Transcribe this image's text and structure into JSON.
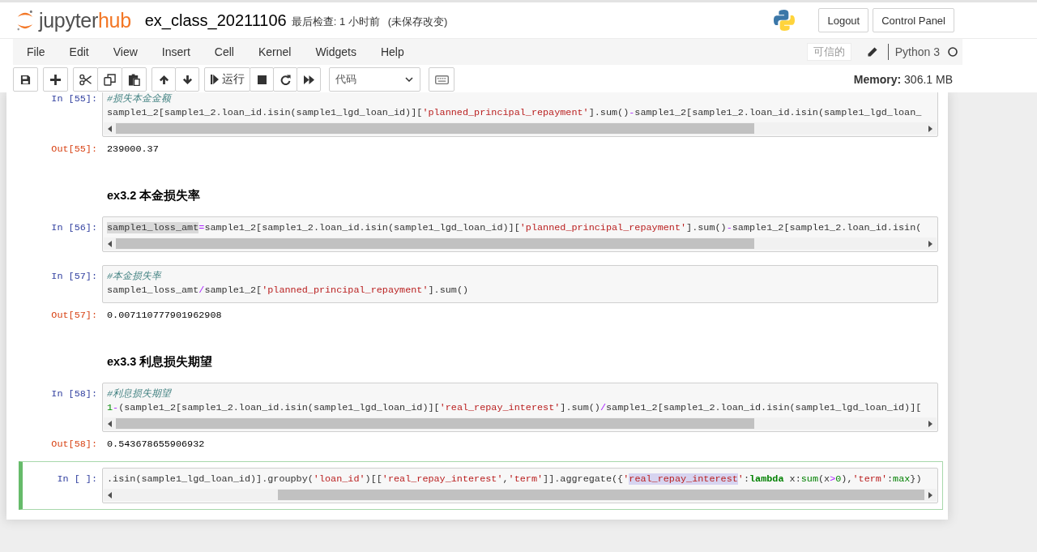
{
  "header": {
    "logo": {
      "primary": "jupyter",
      "accent": "hub"
    },
    "notebook_name": "ex_class_20211106",
    "checkpoint": "最后检查: 1 小时前",
    "autosave_status": "(未保存改变)",
    "buttons": [
      "Logout",
      "Control Panel"
    ]
  },
  "menubar": {
    "items": [
      "File",
      "Edit",
      "View",
      "Insert",
      "Cell",
      "Kernel",
      "Widgets",
      "Help"
    ],
    "trusted": "可信的",
    "edit_mode": true,
    "kernel": {
      "name": "Python 3",
      "busy": false
    }
  },
  "toolbar": {
    "groups": [
      [
        {
          "kind": "save"
        }
      ],
      [
        {
          "kind": "insert-below"
        }
      ],
      [
        {
          "kind": "cut"
        },
        {
          "kind": "copy"
        },
        {
          "kind": "paste"
        }
      ],
      [
        {
          "kind": "move-up"
        },
        {
          "kind": "move-down"
        }
      ],
      [
        {
          "kind": "run",
          "label": "运行"
        },
        {
          "kind": "interrupt"
        },
        {
          "kind": "restart"
        },
        {
          "kind": "restart-run-all"
        }
      ],
      [
        {
          "kind": "cell-type",
          "value": "代码"
        }
      ],
      [
        {
          "kind": "command-palette"
        }
      ]
    ],
    "memory": "**Memory:** 306.1 MB"
  },
  "notebook": {
    "cells": [
      {
        "kind": "code",
        "selected": false,
        "prompt": "In [55]:",
        "scrolled": false,
        "input": [
          [
            {
              "kind": "comment",
              "text": "#损失本金金额"
            }
          ],
          [
            {
              "kind": "plain",
              "text": "sample1_2[sample1_2.loan_id.isin(sample1_lgd_loan_id)]["
            },
            {
              "kind": "string",
              "text": "'planned_principal_repayment'"
            },
            {
              "kind": "plain",
              "text": "].sum()"
            },
            {
              "kind": "operator",
              "text": "-"
            },
            {
              "kind": "plain",
              "text": "sample1_2[sample1_2.loan_id.isin(sample1_lgd_loan_"
            }
          ]
        ],
        "output": {
          "prompt": "Out[55]:",
          "text": "239000.37"
        }
      },
      {
        "kind": "markdown",
        "selected": false,
        "heading": "ex3.2 本金损失率"
      },
      {
        "kind": "code",
        "selected": false,
        "prompt": "In [56]:",
        "scrolled": false,
        "input": [
          [
            {
              "kind": "plain",
              "text": "sample1_loss_amt",
              "highlighted": true
            },
            {
              "kind": "operator",
              "text": "="
            },
            {
              "kind": "plain",
              "text": "sample1_2[sample1_2.loan_id.isin(sample1_lgd_loan_id)]["
            },
            {
              "kind": "string",
              "text": "'planned_principal_repayment'"
            },
            {
              "kind": "plain",
              "text": "].sum()"
            },
            {
              "kind": "operator",
              "text": "-"
            },
            {
              "kind": "plain",
              "text": "sample1_2[sample1_2.loan_id.isin("
            }
          ]
        ]
      },
      {
        "kind": "code",
        "selected": false,
        "prompt": "In [57]:",
        "input": [
          [
            {
              "kind": "comment",
              "text": "#本金损失率"
            }
          ],
          [
            {
              "kind": "plain",
              "text": "sample1_loss_amt"
            },
            {
              "kind": "operator",
              "text": "/"
            },
            {
              "kind": "plain",
              "text": "sample1_2["
            },
            {
              "kind": "string",
              "text": "'planned_principal_repayment'"
            },
            {
              "kind": "plain",
              "text": "].sum()"
            }
          ]
        ],
        "output": {
          "prompt": "Out[57]:",
          "text": "0.007110777901962908"
        }
      },
      {
        "kind": "markdown",
        "selected": false,
        "heading": "ex3.3 利息损失期望"
      },
      {
        "kind": "code",
        "selected": false,
        "prompt": "In [58]:",
        "scrolled": false,
        "input": [
          [
            {
              "kind": "comment",
              "text": "#利息损失期望"
            }
          ],
          [
            {
              "kind": "number",
              "text": "1"
            },
            {
              "kind": "operator",
              "text": "-"
            },
            {
              "kind": "plain",
              "text": "(sample1_2[sample1_2.loan_id.isin(sample1_lgd_loan_id)]["
            },
            {
              "kind": "string",
              "text": "'real_repay_interest'"
            },
            {
              "kind": "plain",
              "text": "].sum()"
            },
            {
              "kind": "operator",
              "text": "/"
            },
            {
              "kind": "plain",
              "text": "sample1_2[sample1_2.loan_id.isin(sample1_lgd_loan_id)]["
            }
          ]
        ],
        "output": {
          "prompt": "Out[58]:",
          "text": "0.543678655906932"
        }
      },
      {
        "kind": "code",
        "selected": true,
        "prompt": "In [ ]:",
        "scrolled": true,
        "input": [
          [
            {
              "kind": "plain",
              "text": ".isin(sample1_lgd_loan_id)].groupby("
            },
            {
              "kind": "string",
              "text": "'loan_id'"
            },
            {
              "kind": "plain",
              "text": ")[["
            },
            {
              "kind": "string",
              "text": "'real_repay_interest'"
            },
            {
              "kind": "plain",
              "text": ","
            },
            {
              "kind": "string",
              "text": "'term'"
            },
            {
              "kind": "plain",
              "text": "]].aggregate({"
            },
            {
              "kind": "string",
              "text": "'"
            },
            {
              "kind": "string",
              "text": "real_repay_interest",
              "highlighted": true
            },
            {
              "kind": "string",
              "text": "'"
            },
            {
              "kind": "plain",
              "text": ":"
            },
            {
              "kind": "keyword",
              "text": "lambda"
            },
            {
              "kind": "plain",
              "text": " x:"
            },
            {
              "kind": "builtin",
              "text": "sum"
            },
            {
              "kind": "plain",
              "text": "(x"
            },
            {
              "kind": "operator",
              "text": ">"
            },
            {
              "kind": "number",
              "text": "0"
            },
            {
              "kind": "plain",
              "text": "),"
            },
            {
              "kind": "string",
              "text": "'term'"
            },
            {
              "kind": "plain",
              "text": ":"
            },
            {
              "kind": "builtin",
              "text": "max"
            },
            {
              "kind": "plain",
              "text": "})"
            }
          ]
        ]
      }
    ]
  }
}
